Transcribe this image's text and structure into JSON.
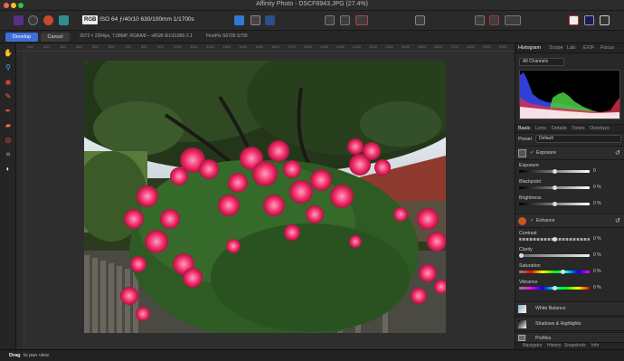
{
  "app": {
    "window_title": "Affinity Photo - DSCF6943.JPG (27.4%)"
  },
  "toolbar": {
    "color_badge": "RGB",
    "exif_info": "ISO 64 ƒ/40/10 630/100mm 1/1700s"
  },
  "context": {
    "develop_label": "Develop",
    "cancel_label": "Cancel",
    "image_info": "3072 × 2304px, 7.08MP, RGBA/8 – sRGB IEC61966-2.1",
    "camera": "FinePix S6700 S700"
  },
  "tools": [
    "hand-icon",
    "zoom-icon",
    "view-icon",
    "brush-icon",
    "pen-icon",
    "eraser-icon",
    "target-icon",
    "crop-icon",
    "mask-icon"
  ],
  "rulers": {
    "h_ticks": [
      "100",
      "200",
      "300",
      "400",
      "500",
      "600",
      "700",
      "800",
      "900",
      "1000",
      "1100",
      "1200",
      "1300",
      "1400",
      "1500",
      "1600",
      "1700",
      "1800",
      "1900",
      "2000",
      "2100",
      "2200",
      "2300",
      "2400",
      "2500",
      "2600",
      "2700",
      "2800",
      "2900",
      "3000"
    ]
  },
  "panel": {
    "top_tabs": [
      "Histogram",
      "Scope",
      "Lab",
      "EXIF",
      "Focus"
    ],
    "channel": "All Channels",
    "section_tabs": [
      "Basic",
      "Lens",
      "Details",
      "Tones",
      "Overlays"
    ],
    "preset_label": "Preset",
    "preset_value": "Default",
    "exposure_group": "Exposure",
    "sliders_a": [
      {
        "label": "Exposure",
        "value": "0",
        "pos": 0.5
      },
      {
        "label": "Blackpoint",
        "value": "0 %",
        "pos": 0.5
      },
      {
        "label": "Brightness",
        "value": "0 %",
        "pos": 0.5
      }
    ],
    "enhance_group": "Enhance",
    "sliders_b": [
      {
        "label": "Contrast",
        "value": "0 %",
        "pos": 0.5
      },
      {
        "label": "Clarity",
        "value": "0 %",
        "pos": 0.02
      },
      {
        "label": "Saturation",
        "value": "0 %",
        "pos": 0.62
      },
      {
        "label": "Vibrance",
        "value": "0 %",
        "pos": 0.5
      }
    ],
    "groups": [
      "White Balance",
      "Shadows & Highlights",
      "Profiles"
    ],
    "bottom_tabs": [
      "Navigator",
      "History",
      "Snapshots",
      "Info"
    ]
  },
  "status": {
    "bold": "Drag",
    "rest": "to pan view."
  },
  "colors": {
    "accent": "#3d6fd6",
    "panel_bg": "#282828"
  }
}
